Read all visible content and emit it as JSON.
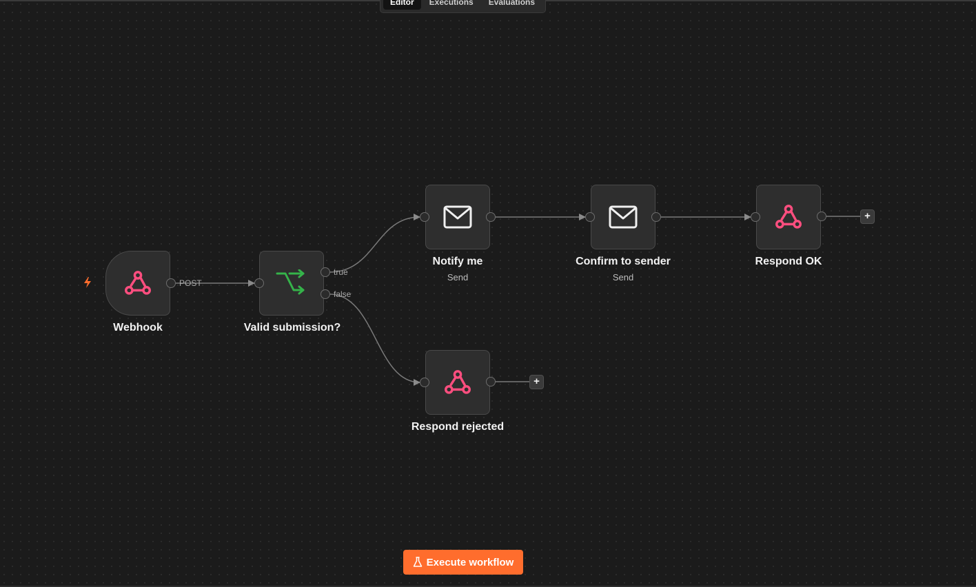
{
  "header": {
    "tabs": [
      {
        "label": "Editor",
        "active": true
      },
      {
        "label": "Executions",
        "active": false
      },
      {
        "label": "Evaluations",
        "active": false
      }
    ]
  },
  "nodes": {
    "webhook": {
      "name": "Webhook",
      "icon": "webhook-icon"
    },
    "valid_submission": {
      "name": "Valid submission?",
      "icon": "if-branch-icon"
    },
    "notify_me": {
      "name": "Notify me",
      "subtitle": "Send",
      "icon": "mail-icon"
    },
    "confirm_to_sender": {
      "name": "Confirm to sender",
      "subtitle": "Send",
      "icon": "mail-icon"
    },
    "respond_ok": {
      "name": "Respond OK",
      "icon": "webhook-icon"
    },
    "respond_rejected": {
      "name": "Respond rejected",
      "icon": "webhook-icon"
    }
  },
  "connections": {
    "webhook_out_label": "POST",
    "if_true_label": "true",
    "if_false_label": "false"
  },
  "add_button": {
    "label": "+"
  },
  "footer": {
    "execute_label": "Execute workflow"
  },
  "colors": {
    "canvas_bg": "#1b1b1b",
    "node_bg": "#2e2e2e",
    "webhook_pink": "#ff4e7f",
    "if_green": "#35b34a",
    "accent_orange": "#ff6d2d"
  }
}
